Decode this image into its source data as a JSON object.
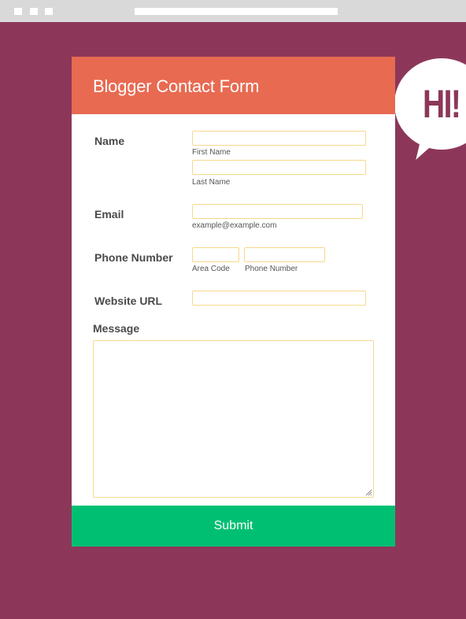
{
  "chrome": {
    "icons": [
      "window-dot",
      "window-dot",
      "window-dot"
    ]
  },
  "bubble": {
    "text": "HI!"
  },
  "form": {
    "title": "Blogger Contact Form",
    "name": {
      "label": "Name",
      "first_sublabel": "First Name",
      "last_sublabel": "Last Name",
      "first_value": "",
      "last_value": ""
    },
    "email": {
      "label": "Email",
      "sublabel": "example@example.com",
      "value": ""
    },
    "phone": {
      "label": "Phone Number",
      "area_sublabel": "Area Code",
      "number_sublabel": "Phone Number",
      "area_value": "",
      "number_value": ""
    },
    "website": {
      "label": "Website URL",
      "value": ""
    },
    "message": {
      "label": "Message",
      "value": ""
    },
    "submit_label": "Submit"
  },
  "colors": {
    "background": "#8c3759",
    "header": "#e86a51",
    "submit": "#00bf73",
    "field_border": "#f7d98d"
  }
}
